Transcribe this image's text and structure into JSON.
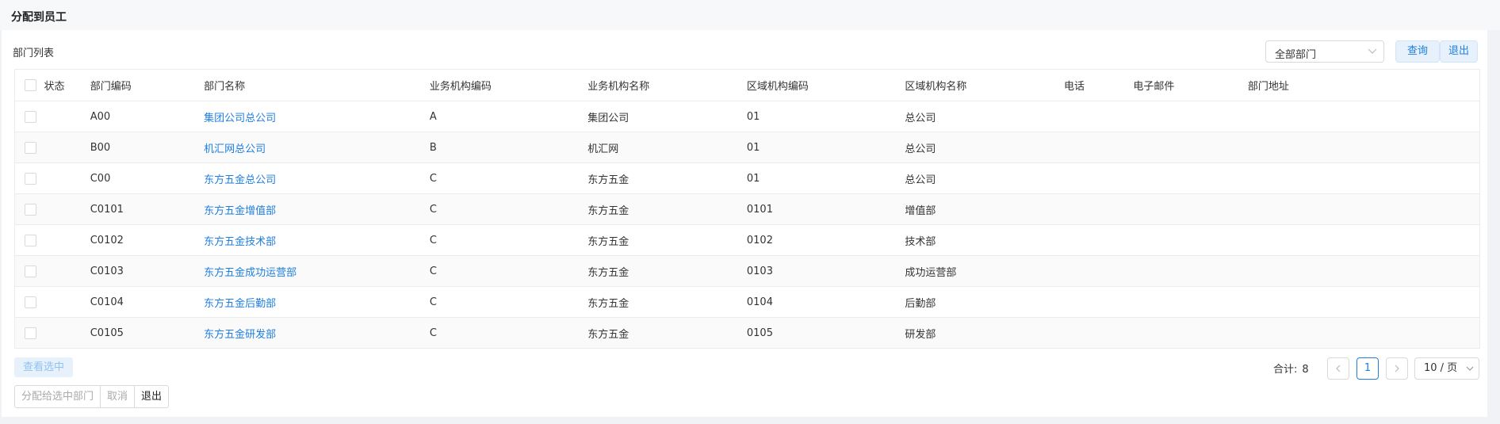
{
  "page": {
    "title": "分配到员工"
  },
  "toolbar": {
    "list_title": "部门列表",
    "dept_select": "全部部门",
    "query_label": "查询",
    "exit_label": "退出"
  },
  "table": {
    "headers": [
      "状态",
      "部门编码",
      "部门名称",
      "业务机构编码",
      "业务机构名称",
      "区域机构编码",
      "区域机构名称",
      "电话",
      "电子邮件",
      "部门地址"
    ],
    "rows": [
      {
        "status": "",
        "code": "A00",
        "name": "集团公司总公司",
        "biz_code": "A",
        "biz_name": "集团公司",
        "region_code": "01",
        "region_name": "总公司",
        "phone": "",
        "email": "",
        "address": ""
      },
      {
        "status": "",
        "code": "B00",
        "name": "机汇网总公司",
        "biz_code": "B",
        "biz_name": "机汇网",
        "region_code": "01",
        "region_name": "总公司",
        "phone": "",
        "email": "",
        "address": ""
      },
      {
        "status": "",
        "code": "C00",
        "name": "东方五金总公司",
        "biz_code": "C",
        "biz_name": "东方五金",
        "region_code": "01",
        "region_name": "总公司",
        "phone": "",
        "email": "",
        "address": ""
      },
      {
        "status": "",
        "code": "C0101",
        "name": "东方五金增值部",
        "biz_code": "C",
        "biz_name": "东方五金",
        "region_code": "0101",
        "region_name": "增值部",
        "phone": "",
        "email": "",
        "address": ""
      },
      {
        "status": "",
        "code": "C0102",
        "name": "东方五金技术部",
        "biz_code": "C",
        "biz_name": "东方五金",
        "region_code": "0102",
        "region_name": "技术部",
        "phone": "",
        "email": "",
        "address": ""
      },
      {
        "status": "",
        "code": "C0103",
        "name": "东方五金成功运营部",
        "biz_code": "C",
        "biz_name": "东方五金",
        "region_code": "0103",
        "region_name": "成功运营部",
        "phone": "",
        "email": "",
        "address": ""
      },
      {
        "status": "",
        "code": "C0104",
        "name": "东方五金后勤部",
        "biz_code": "C",
        "biz_name": "东方五金",
        "region_code": "0104",
        "region_name": "后勤部",
        "phone": "",
        "email": "",
        "address": ""
      },
      {
        "status": "",
        "code": "C0105",
        "name": "东方五金研发部",
        "biz_code": "C",
        "biz_name": "东方五金",
        "region_code": "0105",
        "region_name": "研发部",
        "phone": "",
        "email": "",
        "address": ""
      }
    ]
  },
  "footer": {
    "view_selected": "查看选中",
    "total_label": "合计:",
    "total_value": "8",
    "current_page": "1",
    "page_size": "10 / 页",
    "assign_label": "分配给选中部门",
    "cancel_label": "取消",
    "exit_label": "退出"
  },
  "colors": {
    "accent": "#1f7fe0",
    "accent_light": "#e6f1fc"
  },
  "icons": {
    "select_arrow": "chevron-down-icon",
    "prev": "chevron-left-icon",
    "next": "chevron-right-icon"
  }
}
